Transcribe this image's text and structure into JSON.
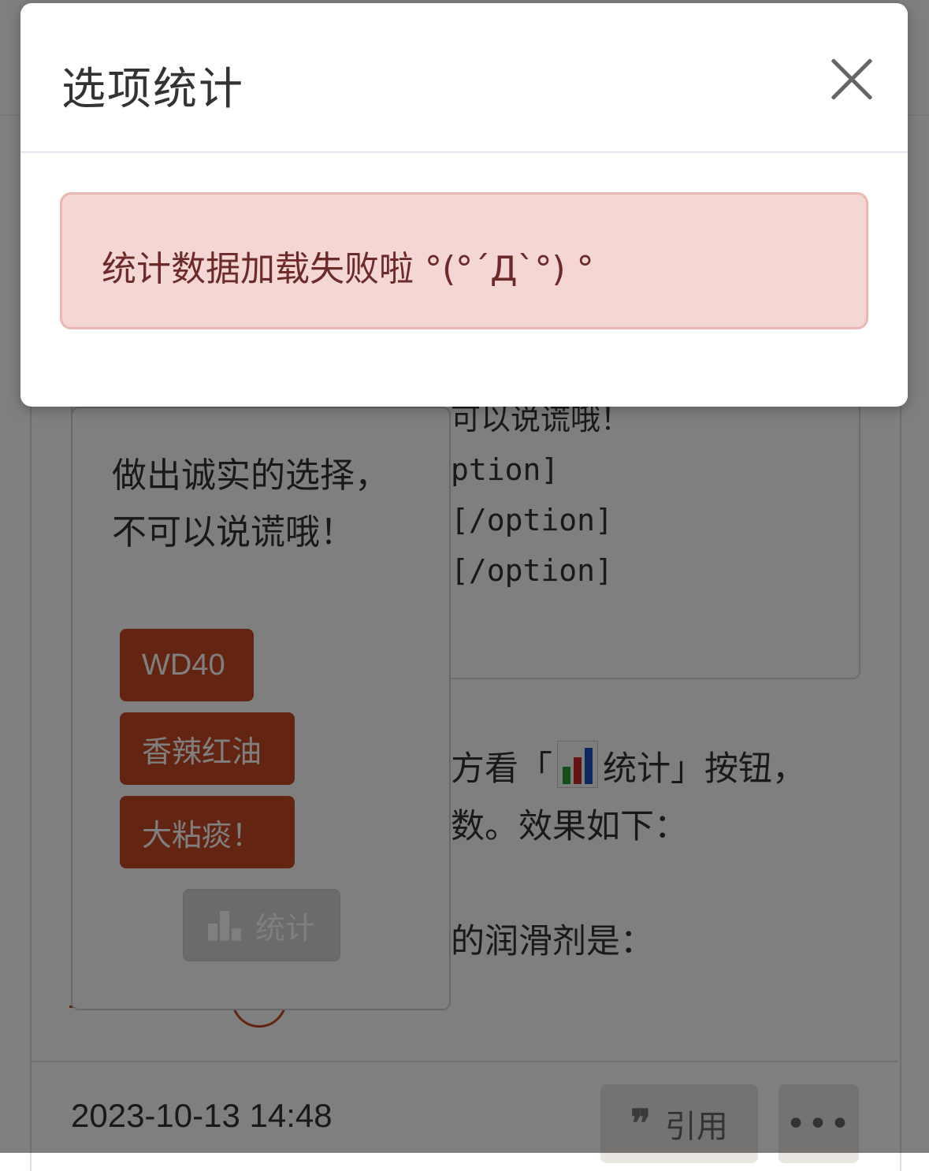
{
  "modal": {
    "title": "选项统计",
    "error_message": "统计数据加载失败啦 °(°´Д`°) °"
  },
  "code_block": {
    "lines": [
      "可以说谎哦！",
      "ption]",
      "[/option]",
      "[/option]"
    ]
  },
  "article": {
    "line1_before": "方看「",
    "line1_after": "统计」按钮，",
    "line2": "数。效果如下：",
    "line3": "的润滑剂是："
  },
  "poll": {
    "question": "做出诚实的选择，不可以说谎哦！",
    "options": [
      "WD40",
      "香辣红油",
      "大粘痰！"
    ],
    "stats_label": "统计"
  },
  "footer": {
    "timestamp": "2023-10-13 14:48",
    "quote_label": "引用",
    "more_label": "•••"
  },
  "colors": {
    "accent": "#c64a24",
    "alert_bg": "#f4d7d5",
    "alert_border": "#ebb8b4",
    "alert_text": "#6d2a2a"
  }
}
